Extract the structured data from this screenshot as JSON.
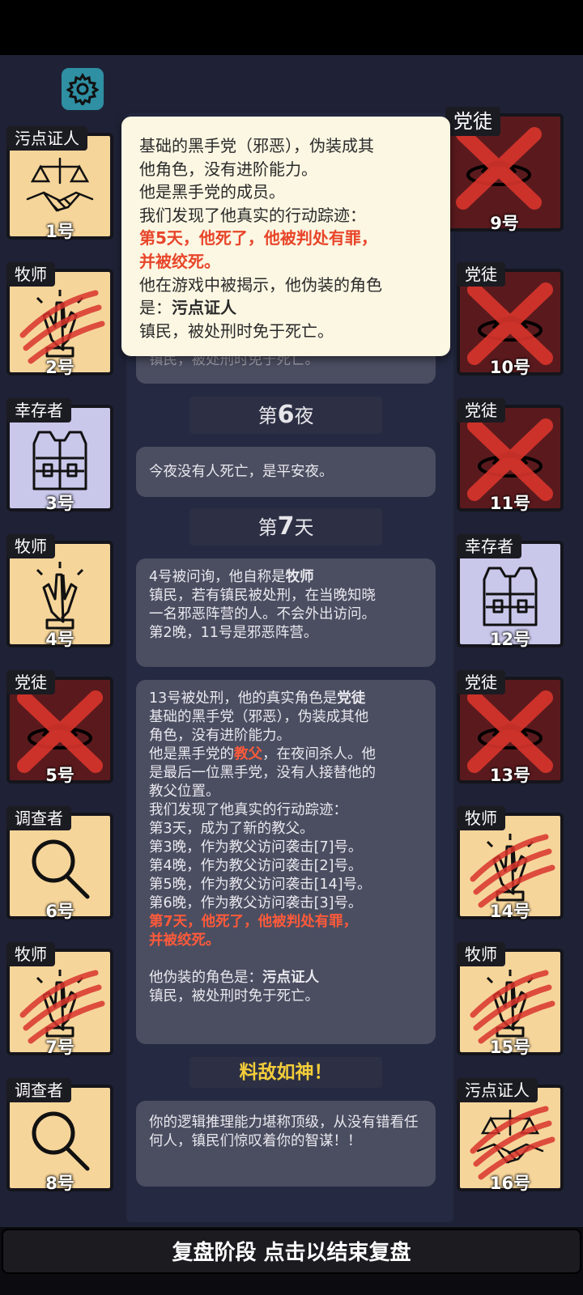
{
  "players": [
    {
      "role": "污点证人",
      "num": "1号",
      "icon": "scales-handshake-icon",
      "bg": "beige",
      "mark": "none"
    },
    {
      "role": "牧师",
      "num": "2号",
      "icon": "praying-hands-icon",
      "bg": "beige",
      "mark": "slash"
    },
    {
      "role": "幸存者",
      "num": "3号",
      "icon": "vest-icon",
      "bg": "lav",
      "mark": "none"
    },
    {
      "role": "牧师",
      "num": "4号",
      "icon": "praying-hands-icon",
      "bg": "beige",
      "mark": "none"
    },
    {
      "role": "党徒",
      "num": "5号",
      "icon": "hat-icon",
      "bg": "red",
      "mark": "x"
    },
    {
      "role": "调查者",
      "num": "6号",
      "icon": "magnifier-icon",
      "bg": "beige",
      "mark": "none"
    },
    {
      "role": "牧师",
      "num": "7号",
      "icon": "praying-hands-icon",
      "bg": "beige",
      "mark": "slash"
    },
    {
      "role": "调查者",
      "num": "8号",
      "icon": "magnifier-icon",
      "bg": "beige",
      "mark": "none"
    },
    {
      "role": "党徒",
      "num": "9号",
      "icon": "hat-icon",
      "bg": "red",
      "mark": "x"
    },
    {
      "role": "党徒",
      "num": "10号",
      "icon": "hat-icon",
      "bg": "red",
      "mark": "x"
    },
    {
      "role": "党徒",
      "num": "11号",
      "icon": "hat-icon",
      "bg": "red",
      "mark": "x"
    },
    {
      "role": "幸存者",
      "num": "12号",
      "icon": "vest-icon",
      "bg": "lav",
      "mark": "none"
    },
    {
      "role": "党徒",
      "num": "13号",
      "icon": "hat-icon",
      "bg": "red",
      "mark": "x"
    },
    {
      "role": "牧师",
      "num": "14号",
      "icon": "praying-hands-icon",
      "bg": "beige",
      "mark": "slash"
    },
    {
      "role": "牧师",
      "num": "15号",
      "icon": "praying-hands-icon",
      "bg": "beige",
      "mark": "slash"
    },
    {
      "role": "污点证人",
      "num": "16号",
      "icon": "scales-handshake-icon",
      "bg": "beige",
      "mark": "slash"
    }
  ],
  "log": {
    "partial_line": "镇民，被处刑时免于死亡。",
    "night6_prefix": "第",
    "night6_num": "6",
    "night6_suffix": "夜",
    "night6_msg": "今夜没有人死亡，是平安夜。",
    "day7_prefix": "第",
    "day7_num": "7",
    "day7_suffix": "天",
    "day7_msg1": [
      "4号被问询，他自称是",
      "牧师",
      "镇民，若有镇民被处刑，在当晚知晓",
      "一名邪恶阵营的人。不会外出访问。",
      "第2晚，11号是邪恶阵营。"
    ],
    "day7_msg2": {
      "l1a": "13号被处刑，他的真实角色是",
      "l1b": "党徒",
      "l2": "基础的黑手党（邪恶），伪装成其他",
      "l3": "角色，没有进阶能力。",
      "l4a": "他是黑手党的",
      "l4b": "教父",
      "l4c": "，在夜间杀人。他",
      "l5": "是最后一位黑手党，没有人接替他的",
      "l6": "教父位置。",
      "l7": "我们发现了他真实的行动踪迹：",
      "l8": "第3天，成为了新的教父。",
      "l9": "第3晚，作为教父访问袭击[7]号。",
      "l10": "第4晚，作为教父访问袭击[2]号。",
      "l11": "第5晚，作为教父访问袭击[14]号。",
      "l12": "第6晚，作为教父访问袭击[3]号。",
      "l13": "第7天，他死了，他被判处有罪，",
      "l14": "并被绞死。",
      "l15a": "他伪装的角色是：",
      "l15b": "污点证人",
      "l16": "镇民，被处刑时免于死亡。"
    },
    "result_title": "料敌如神！",
    "result_msg": "你的逻辑推理能力堪称顶级，从没有错看任何人，镇民们惊叹着你的智谋！！"
  },
  "popup": {
    "l1": "基础的黑手党（邪恶），伪装成其",
    "l2": "他角色，没有进阶能力。",
    "l3": "他是黑手党的成员。",
    "l4": "我们发现了他真实的行动踪迹：",
    "l5": "第5天，他死了，他被判处有罪，",
    "l6": "并被绞死。",
    "l7": "他在游戏中被揭示，他伪装的角色",
    "l8a": "是：",
    "l8b": "污点证人",
    "l9": "镇民，被处刑时免于死亡。"
  },
  "end_button": "复盘阶段 点击以结束复盘"
}
